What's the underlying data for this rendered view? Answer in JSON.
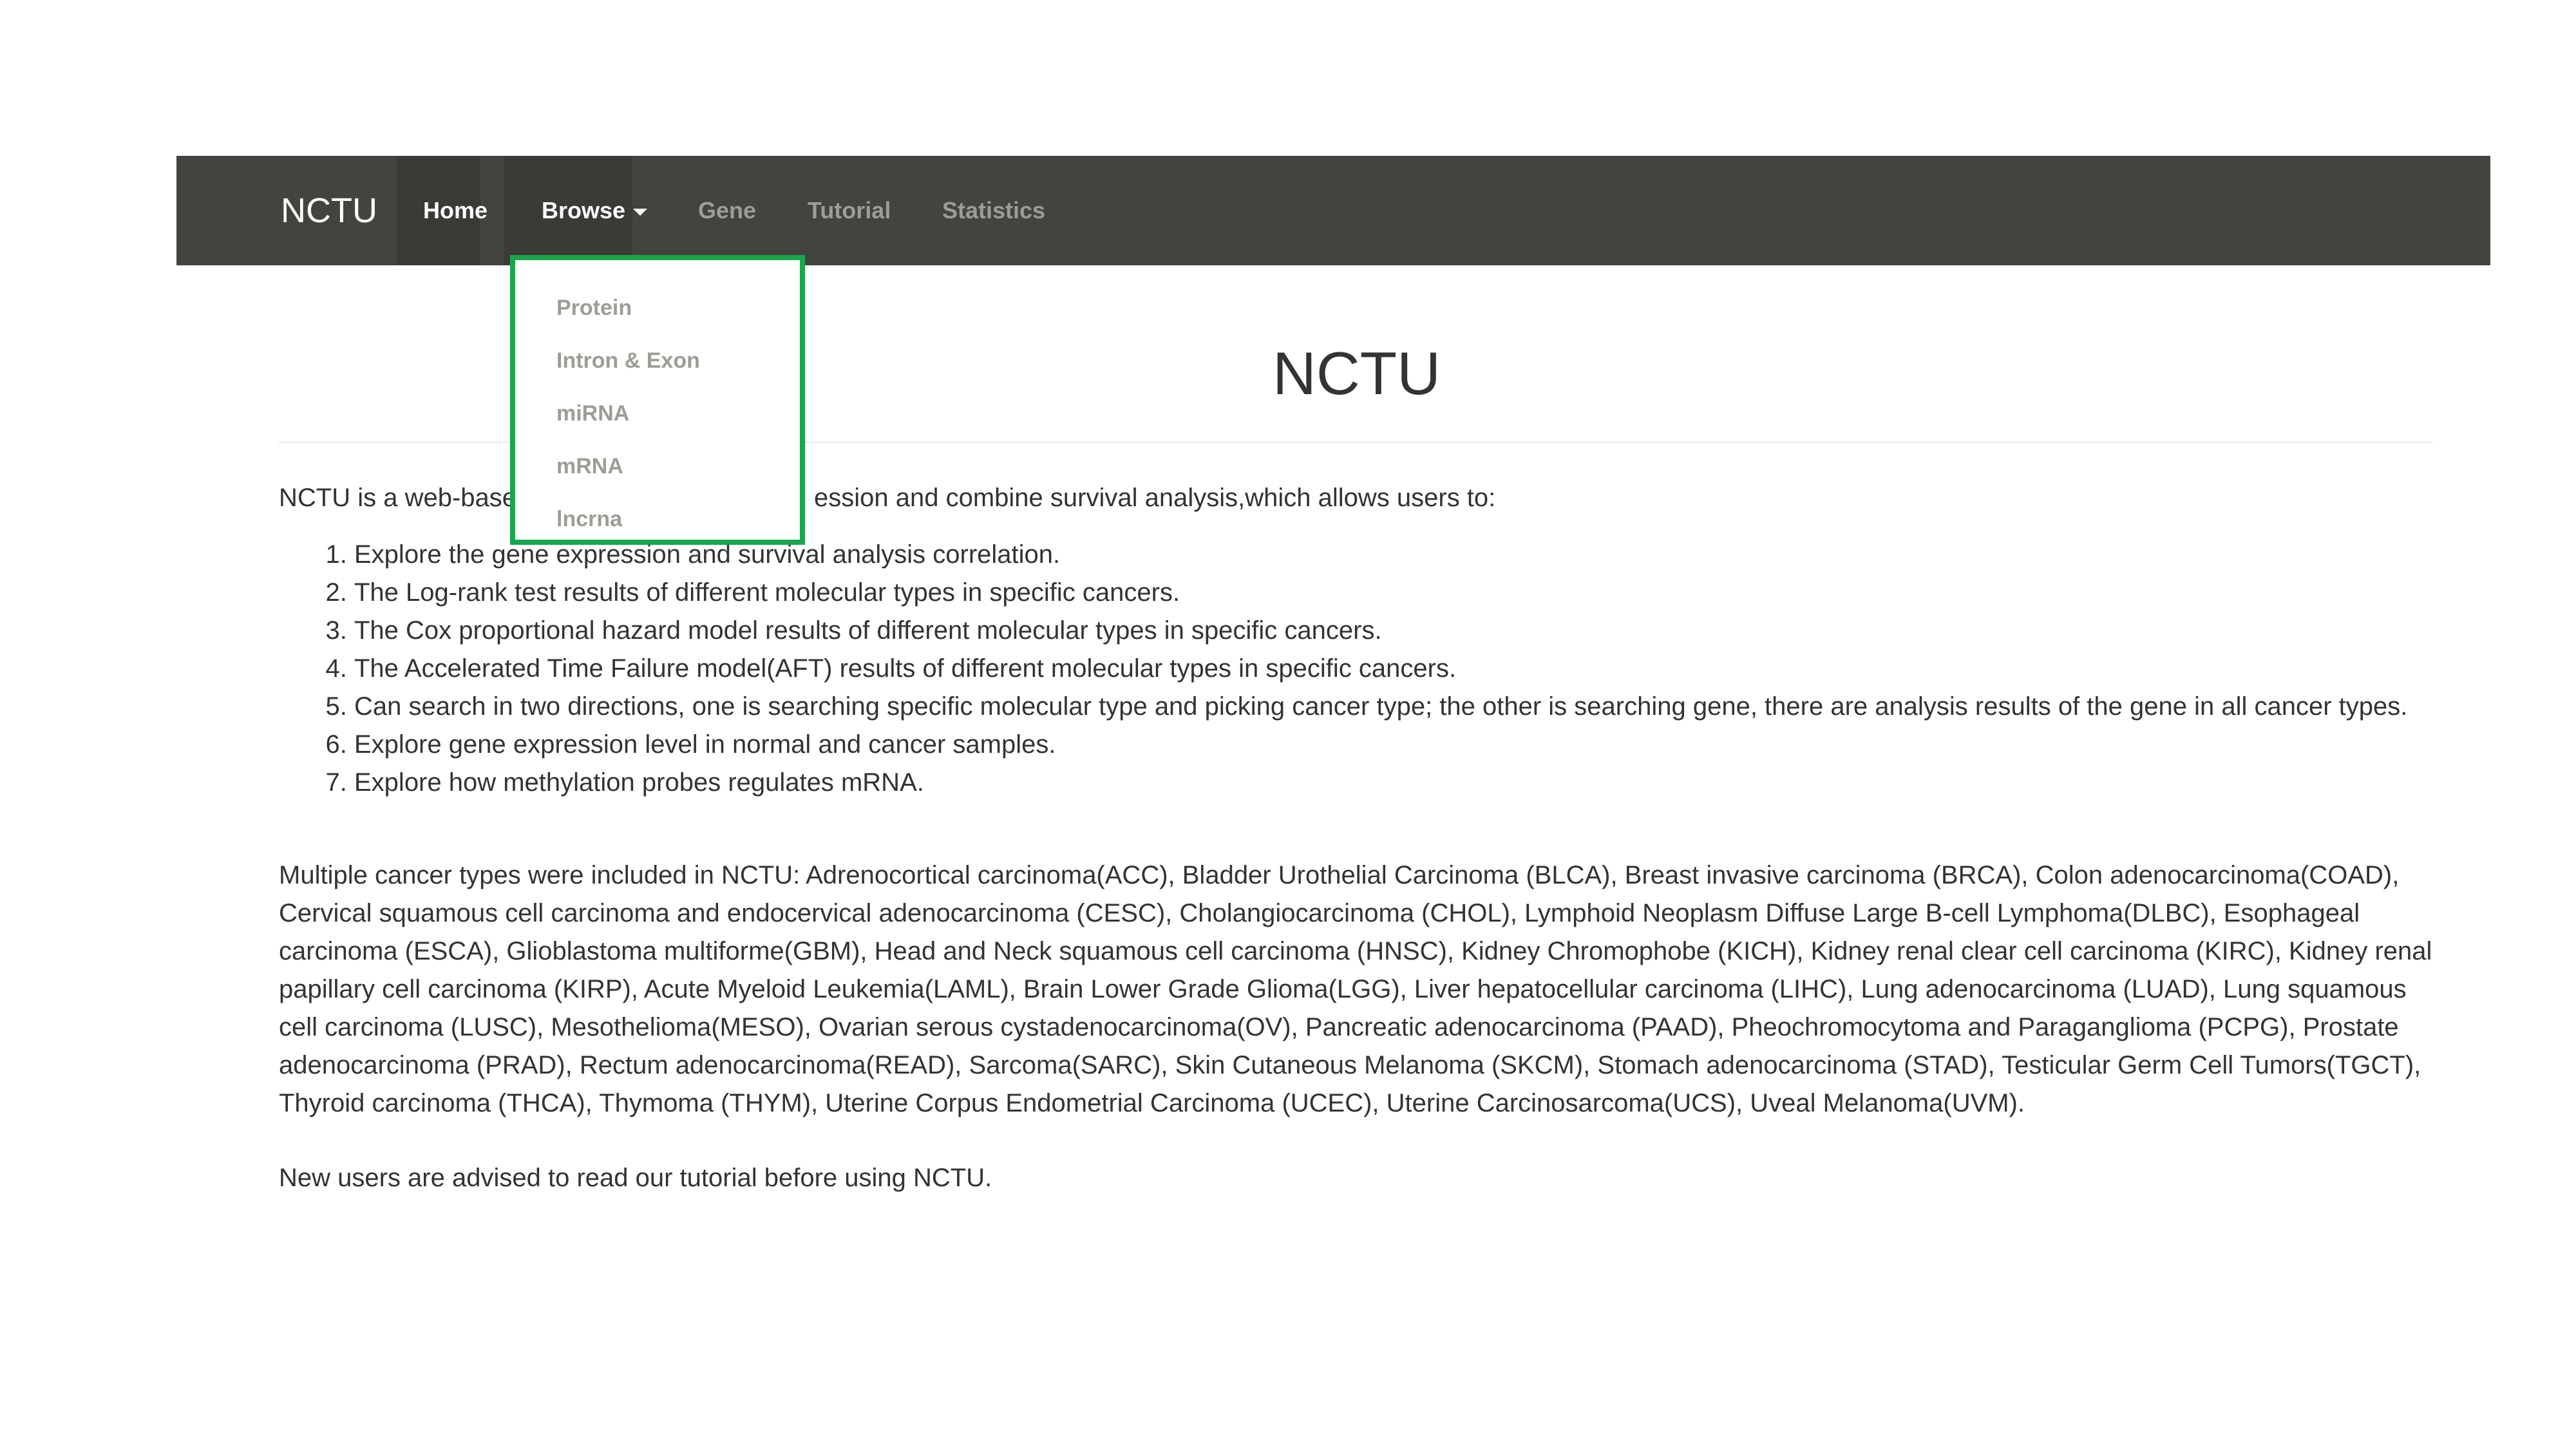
{
  "navbar": {
    "brand": "NCTU",
    "items": [
      {
        "label": "Home"
      },
      {
        "label": "Browse"
      },
      {
        "label": "Gene"
      },
      {
        "label": "Tutorial"
      },
      {
        "label": "Statistics"
      }
    ],
    "background_color": "#434340"
  },
  "dropdown": {
    "border_color": "#1aa64a",
    "items": [
      {
        "label": "Protein"
      },
      {
        "label": "Intron & Exon"
      },
      {
        "label": "miRNA"
      },
      {
        "label": "mRNA"
      },
      {
        "label": "lncrna"
      }
    ]
  },
  "main": {
    "title": "NCTU",
    "intro_start": "NCTU is a web-base",
    "intro_end": "ession and combine survival analysis,which allows users to:",
    "features": [
      "Explore the gene expression and survival analysis correlation.",
      "The Log-rank test results of different molecular types in specific cancers.",
      "The Cox proportional hazard model results of different molecular types in specific cancers.",
      "The Accelerated Time Failure model(AFT) results of different molecular types in specific cancers.",
      "Can search in two directions, one is searching specific molecular type and picking cancer type; the other is searching gene, there are analysis results of the gene in all cancer types.",
      "Explore gene expression level in normal and cancer samples.",
      "Explore how methylation probes regulates mRNA."
    ],
    "cancers_text": "Multiple cancer types were included in NCTU: Adrenocortical carcinoma(ACC), Bladder Urothelial Carcinoma (BLCA), Breast invasive carcinoma (BRCA), Colon adenocarcinoma(COAD), Cervical squamous cell carcinoma and endocervical adenocarcinoma (CESC), Cholangiocarcinoma (CHOL), Lymphoid Neoplasm Diffuse Large B-cell Lymphoma(DLBC), Esophageal carcinoma (ESCA), Glioblastoma multiforme(GBM), Head and Neck squamous cell carcinoma (HNSC), Kidney Chromophobe (KICH), Kidney renal clear cell carcinoma (KIRC), Kidney renal papillary cell carcinoma (KIRP), Acute Myeloid Leukemia(LAML), Brain Lower Grade Glioma(LGG), Liver hepatocellular carcinoma (LIHC), Lung adenocarcinoma (LUAD), Lung squamous cell carcinoma (LUSC), Mesothelioma(MESO), Ovarian serous cystadenocarcinoma(OV), Pancreatic adenocarcinoma (PAAD), Pheochromocytoma and Paraganglioma (PCPG), Prostate adenocarcinoma (PRAD), Rectum adenocarcinoma(READ), Sarcoma(SARC), Skin Cutaneous Melanoma (SKCM), Stomach adenocarcinoma (STAD), Testicular Germ Cell Tumors(TGCT), Thyroid carcinoma (THCA), Thymoma (THYM), Uterine Corpus Endometrial Carcinoma (UCEC), Uterine Carcinosarcoma(UCS), Uveal Melanoma(UVM).",
    "advice": "New users are advised to read our tutorial before using NCTU."
  }
}
